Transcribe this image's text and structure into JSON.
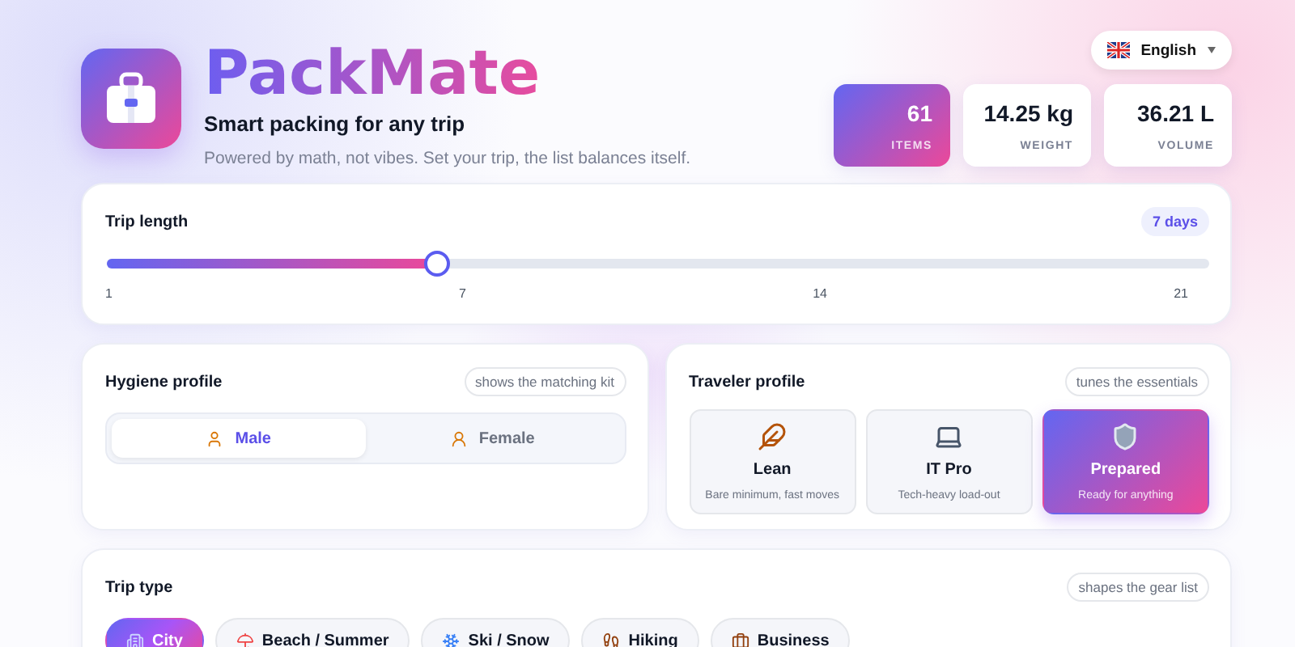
{
  "app": {
    "name": "PackMate",
    "tagline": "Smart packing for any trip",
    "subtitle": "Powered by math, not vibes. Set your trip, the list balances itself."
  },
  "language": {
    "label": "English"
  },
  "stats": [
    {
      "value": "61",
      "label": "ITEMS",
      "selected": true
    },
    {
      "value": "14.25 kg",
      "label": "WEIGHT",
      "selected": false
    },
    {
      "value": "36.21 L",
      "label": "VOLUME",
      "selected": false
    }
  ],
  "trip_length": {
    "title": "Trip length",
    "badge": "7 days",
    "level": 0.3,
    "ticks": [
      "1",
      "7",
      "14",
      "21"
    ]
  },
  "hygiene_profile": {
    "title": "Hygiene profile",
    "hint": "shows the matching kit",
    "options": [
      {
        "label": "Male",
        "kind": "man",
        "selected": true
      },
      {
        "label": "Female",
        "kind": "woman",
        "selected": false
      }
    ]
  },
  "traveler_profile": {
    "title": "Traveler profile",
    "hint": "tunes the essentials",
    "options": [
      {
        "title": "Lean",
        "description": "Bare minimum, fast moves",
        "kind": "feather",
        "selected": false
      },
      {
        "title": "IT Pro",
        "description": "Tech-heavy load-out",
        "kind": "laptop",
        "selected": false
      },
      {
        "title": "Prepared",
        "description": "Ready for anything",
        "kind": "shield",
        "selected": true
      }
    ]
  },
  "trip_type": {
    "title": "Trip type",
    "hint": "shapes the gear list",
    "options": [
      {
        "label": "City",
        "kind": "city",
        "selected": true
      },
      {
        "label": "Beach / Summer",
        "kind": "beach",
        "selected": false
      },
      {
        "label": "Ski / Snow",
        "kind": "ski",
        "selected": false
      },
      {
        "label": "Hiking",
        "kind": "hiking",
        "selected": false
      },
      {
        "label": "Business",
        "kind": "business",
        "selected": false
      }
    ]
  }
}
